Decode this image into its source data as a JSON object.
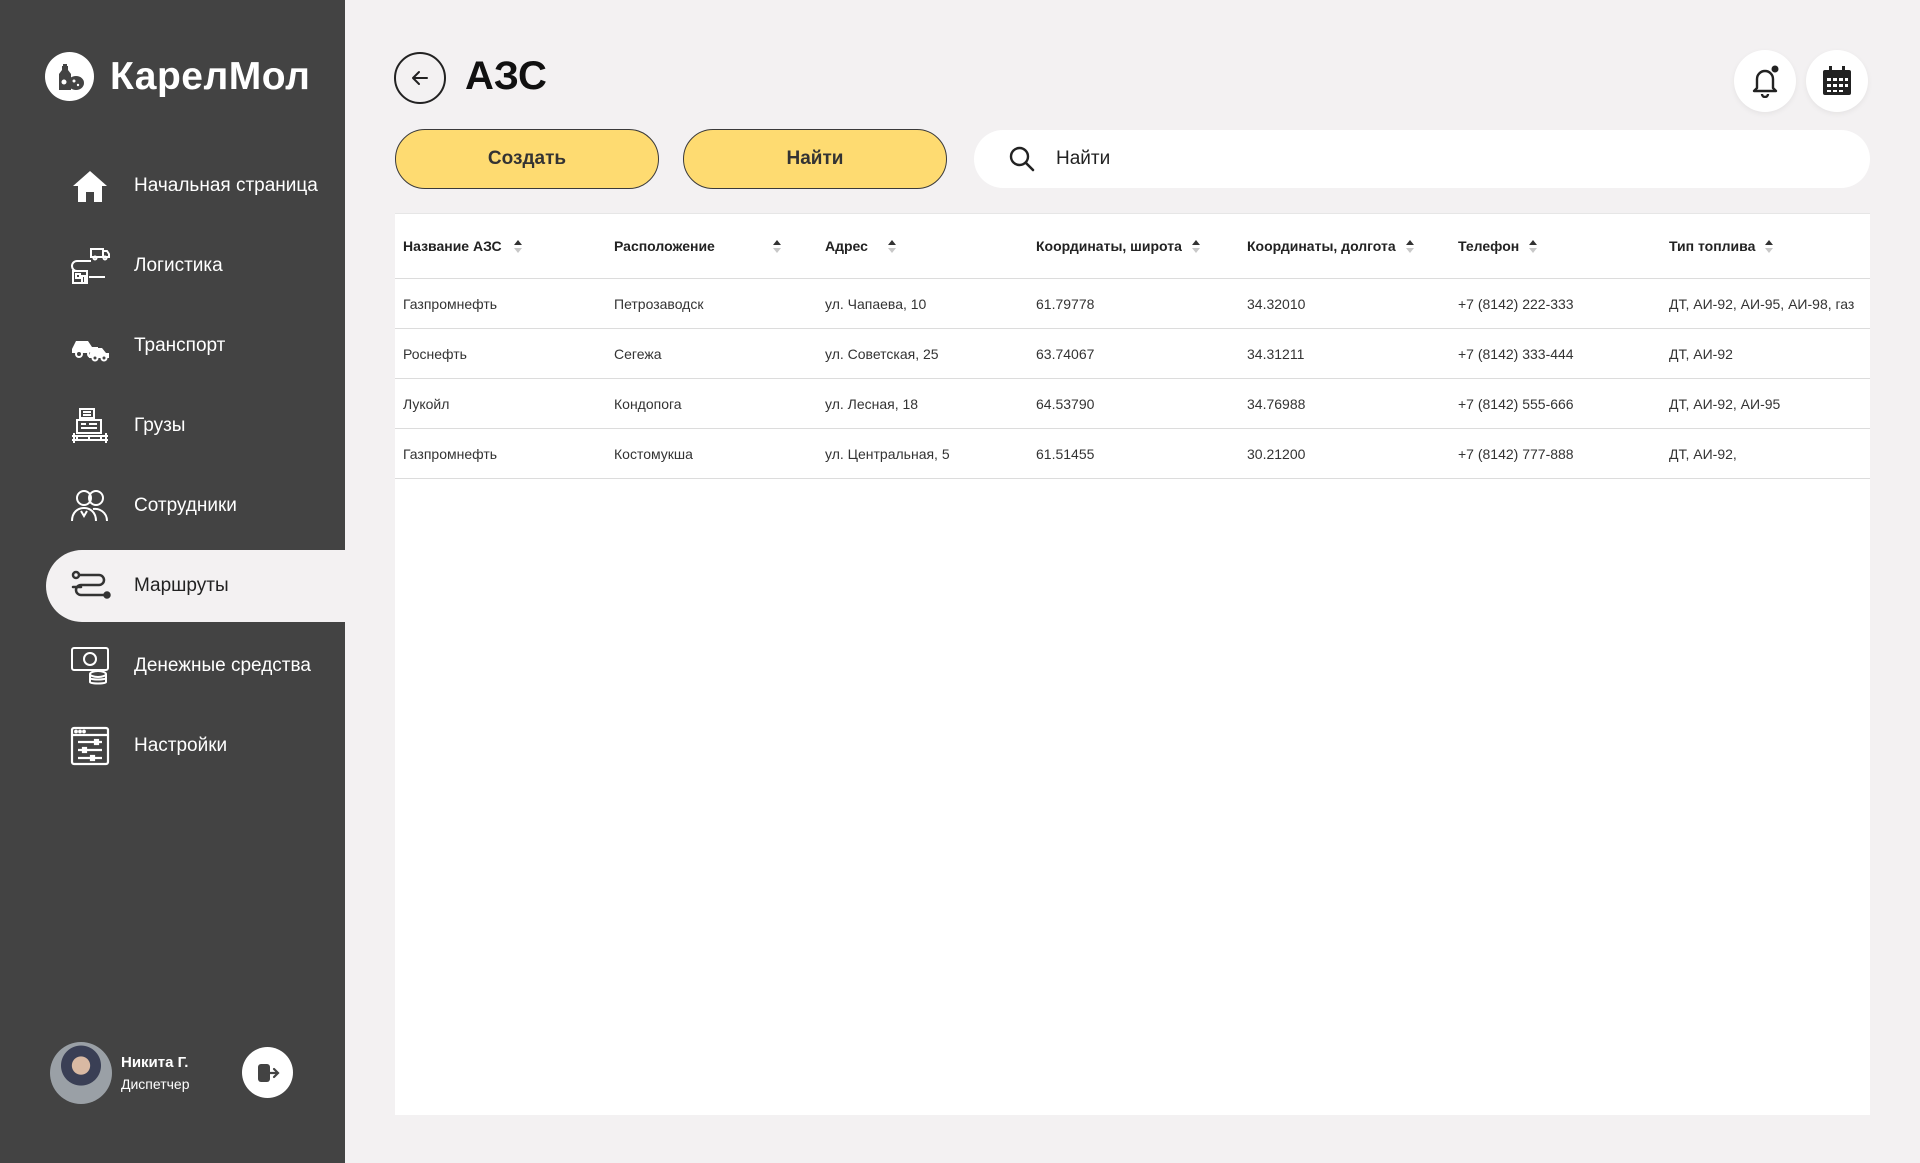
{
  "app": {
    "name": "КарелМол"
  },
  "sidebar": {
    "items": [
      {
        "label": "Начальная страница",
        "icon": "home-icon"
      },
      {
        "label": "Логистика",
        "icon": "logistics-icon"
      },
      {
        "label": "Транспорт",
        "icon": "transport-icon"
      },
      {
        "label": "Грузы",
        "icon": "cargo-icon"
      },
      {
        "label": "Сотрудники",
        "icon": "employees-icon"
      },
      {
        "label": "Маршруты",
        "icon": "routes-icon"
      },
      {
        "label": "Денежные средства",
        "icon": "money-icon"
      },
      {
        "label": "Настройки",
        "icon": "settings-icon"
      }
    ],
    "active": "Маршруты"
  },
  "user": {
    "name": "Никита Г.",
    "role": "Диспетчер"
  },
  "header": {
    "title": "АЗС"
  },
  "actions": {
    "create_label": "Создать",
    "find_label": "Найти"
  },
  "search": {
    "placeholder": "Найти"
  },
  "table": {
    "columns": [
      "Название АЗС",
      "Расположение",
      "Адрес",
      "Координаты, широта",
      "Координаты, долгота",
      "Телефон",
      "Тип топлива"
    ],
    "rows": [
      [
        "Газпромнефть",
        "Петрозаводск",
        "ул. Чапаева, 10",
        "61.79778",
        "34.32010",
        "+7 (8142) 222-333",
        "ДТ, АИ-92, АИ-95, АИ-98, газ"
      ],
      [
        "Роснефть",
        "Сегежа",
        "ул. Советская, 25",
        "63.74067",
        "34.31211",
        "+7 (8142) 333-444",
        "ДТ, АИ-92"
      ],
      [
        "Лукойл",
        "Кондопога",
        "ул. Лесная, 18",
        "64.53790",
        "34.76988",
        "+7 (8142) 555-666",
        "ДТ, АИ-92, АИ-95"
      ],
      [
        "Газпромнефть",
        "Костомукша",
        "ул. Центральная, 5",
        "61.51455",
        "30.21200",
        "+7 (8142) 777-888",
        "ДТ, АИ-92,"
      ]
    ]
  },
  "colors": {
    "sidebar": "#434343",
    "accent": "#fedb71",
    "background": "#f3f1f2"
  }
}
